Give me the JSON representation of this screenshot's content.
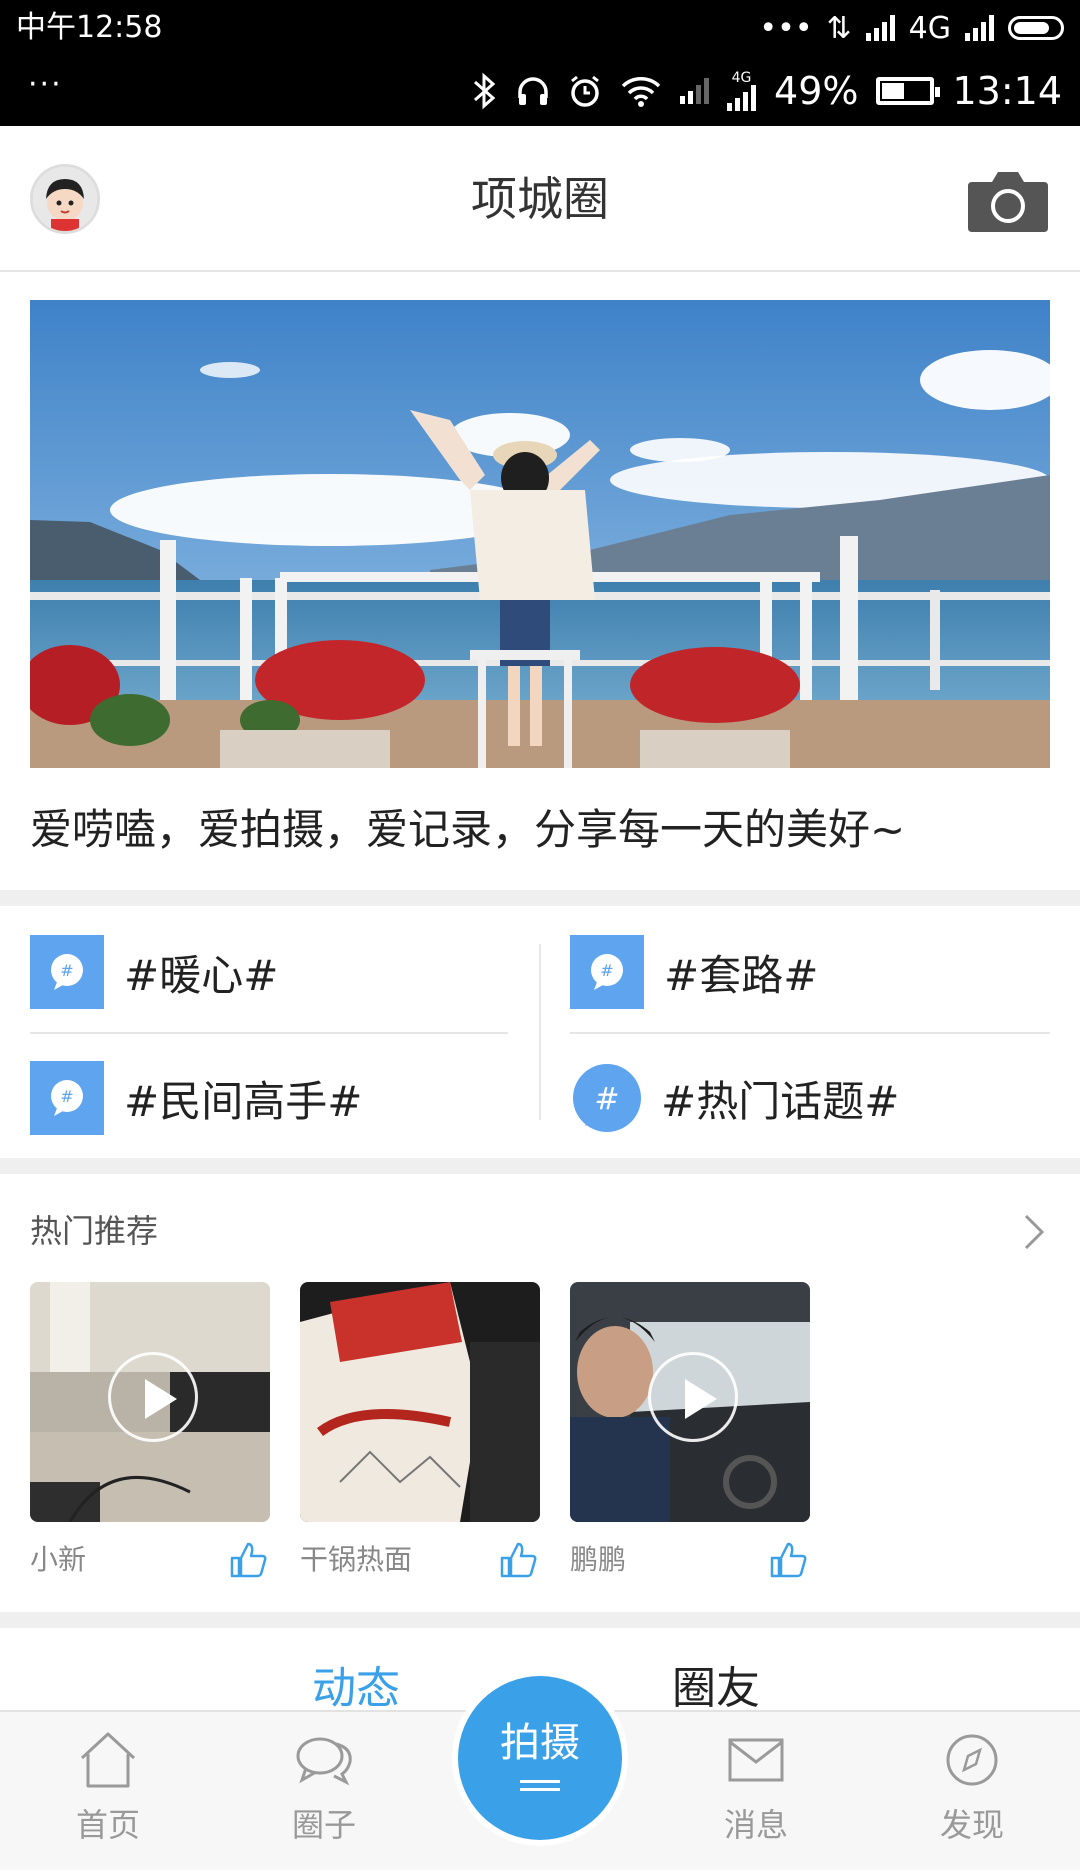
{
  "status_bar": {
    "left_time": "中午12:58",
    "top_network": "4G",
    "left_dots": "···",
    "small_network": "4G",
    "battery": "49%",
    "time": "13:14"
  },
  "header": {
    "title": "项城圈",
    "avatar_icon": "avatar-icon",
    "camera_icon": "camera-icon"
  },
  "banner": {
    "slogan": "爱唠嗑，爱拍摄，爱记录，分享每一天的美好~"
  },
  "topics": [
    {
      "label": "#暖心#",
      "icon": "topic-chat-icon"
    },
    {
      "label": "#套路#",
      "icon": "topic-chat-icon"
    },
    {
      "label": "#民间高手#",
      "icon": "topic-chat-icon"
    },
    {
      "label": "#热门话题#",
      "icon": "topic-bubble-icon"
    }
  ],
  "hot": {
    "title": "热门推荐",
    "items": [
      {
        "name": "小新",
        "video": true
      },
      {
        "name": "干锅热面",
        "video": false
      },
      {
        "name": "鹏鹏",
        "video": true
      }
    ]
  },
  "subtabs": {
    "active": "动态",
    "inactive": "圈友"
  },
  "colors": {
    "accent": "#3aa0e8",
    "topic_badge": "#5ea4ef",
    "active_tab": "#3aa0e8"
  },
  "nav": {
    "home": "首页",
    "circle": "圈子",
    "shoot": "拍摄",
    "messages": "消息",
    "discover": "发现"
  }
}
